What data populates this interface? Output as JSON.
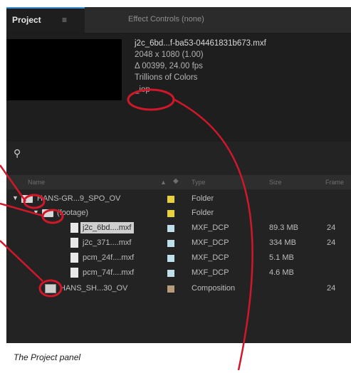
{
  "tabs": {
    "project_label": "Project",
    "project_menu": "≡",
    "effects_label": "Effect Controls (none)"
  },
  "info": {
    "filename": "j2c_6bd...f-ba53-04461831b673.mxf",
    "resolution": "2048 x 1080 (1.00)",
    "duration": "Δ 00399, 24.00 fps",
    "colors": "Trillions of Colors",
    "field_order": "_iop"
  },
  "columns": [
    "Name",
    "Type",
    "Size",
    "Frame"
  ],
  "rows": [
    {
      "name": "HANS-GR...9_SPO_OV",
      "type": "Folder",
      "size": "",
      "rate": "",
      "swatch": "#e8d23a"
    },
    {
      "name": "(footage)",
      "type": "Folder",
      "size": "",
      "rate": "",
      "swatch": "#e8d23a"
    },
    {
      "name": "j2c_6bd....mxf",
      "type": "MXF_DCP",
      "size": "89.3 MB",
      "rate": "24",
      "swatch": "#bfe0ea"
    },
    {
      "name": "j2c_371....mxf",
      "type": "MXF_DCP",
      "size": "334 MB",
      "rate": "24",
      "swatch": "#bfe0ea"
    },
    {
      "name": "pcm_24f....mxf",
      "type": "MXF_DCP",
      "size": "5.1 MB",
      "rate": "",
      "swatch": "#bfe0ea"
    },
    {
      "name": "pcm_74f....mxf",
      "type": "MXF_DCP",
      "size": "4.6 MB",
      "rate": "",
      "swatch": "#bfe0ea"
    },
    {
      "name": "HANS_SH...30_OV",
      "type": "Composition",
      "size": "",
      "rate": "24",
      "swatch": "#b59c7a"
    }
  ],
  "caption": "The Project panel",
  "colors": {
    "accent_tab": "#3d8fd6",
    "callout": "#d0182a"
  }
}
